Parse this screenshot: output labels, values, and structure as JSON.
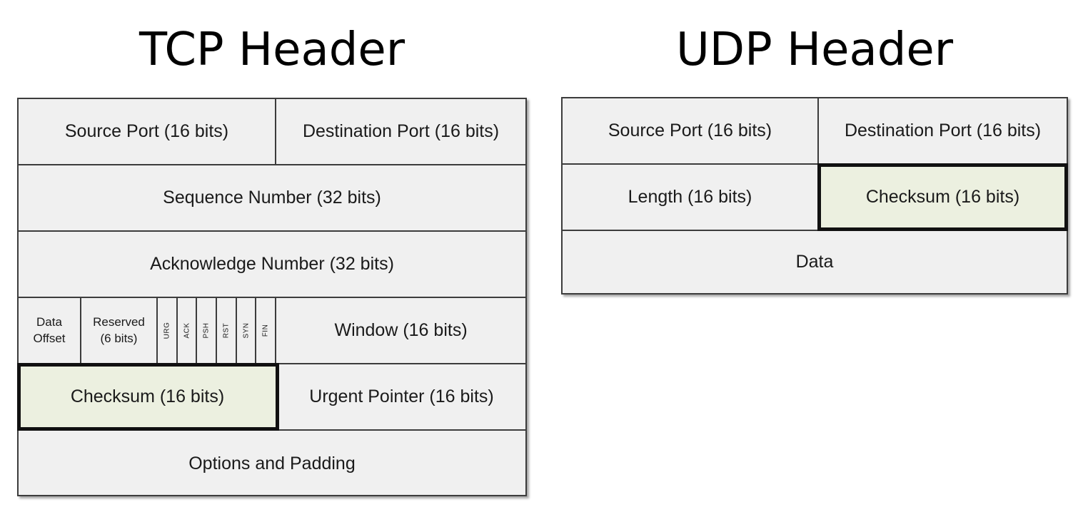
{
  "tcp": {
    "title": "TCP Header",
    "source_port": "Source Port (16 bits)",
    "destination_port": "Destination Port (16 bits)",
    "sequence_number": "Sequence Number (32 bits)",
    "acknowledge_number": "Acknowledge Number (32 bits)",
    "data_offset": "Data\nOffset",
    "reserved": "Reserved\n(6 bits)",
    "flags": [
      "URG",
      "ACK",
      "PSH",
      "RST",
      "SYN",
      "FIN"
    ],
    "window": "Window (16 bits)",
    "checksum": "Checksum (16 bits)",
    "urgent_pointer": "Urgent Pointer (16 bits)",
    "options": "Options and Padding"
  },
  "udp": {
    "title": "UDP Header",
    "source_port": "Source Port (16 bits)",
    "destination_port": "Destination Port (16 bits)",
    "length": "Length (16 bits)",
    "checksum": "Checksum (16 bits)",
    "data": "Data"
  },
  "colors": {
    "cell_fill": "#f0f0f0",
    "highlight_fill": "#ecf0e0",
    "border": "#3c3c3c"
  }
}
